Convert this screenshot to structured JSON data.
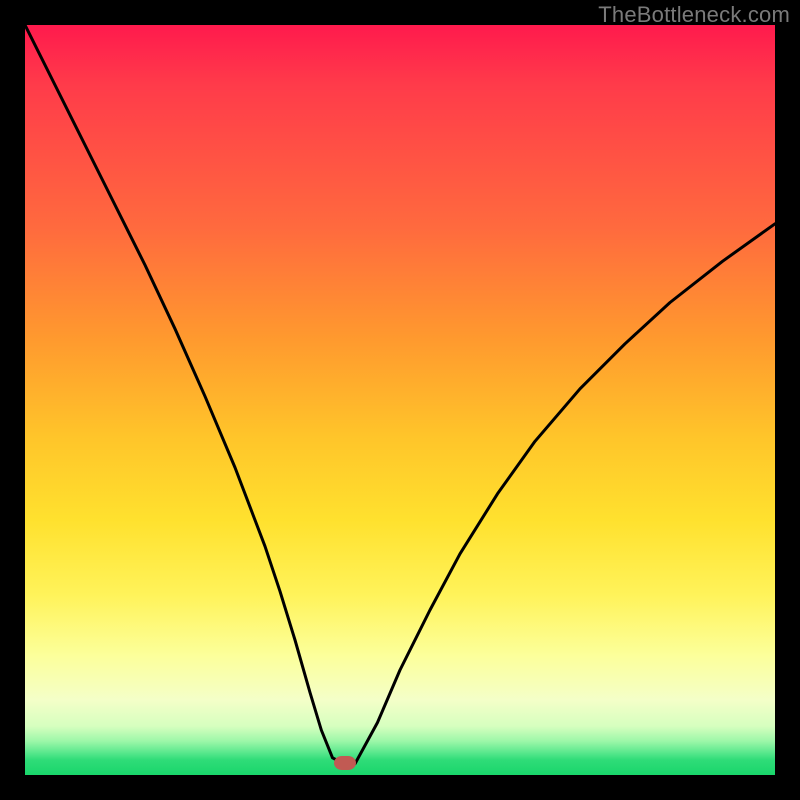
{
  "watermark": {
    "text": "TheBottleneck.com"
  },
  "chart_data": {
    "type": "line",
    "title": "",
    "xlabel": "",
    "ylabel": "",
    "xlim": [
      0,
      100
    ],
    "ylim": [
      0,
      100
    ],
    "grid": false,
    "legend": false,
    "series": [
      {
        "name": "curve",
        "x": [
          0,
          4,
          8,
          12,
          16,
          20,
          24,
          28,
          32,
          34,
          36,
          38,
          39.5,
          41,
          42.5,
          44,
          47,
          50,
          54,
          58,
          63,
          68,
          74,
          80,
          86,
          93,
          100
        ],
        "y": [
          100,
          92,
          84,
          76,
          68,
          59.5,
          50.5,
          41,
          30.5,
          24.5,
          18,
          11,
          6,
          2.3,
          1.5,
          1.5,
          7,
          14,
          22,
          29.5,
          37.5,
          44.5,
          51.5,
          57.5,
          63,
          68.5,
          73.5
        ]
      }
    ],
    "marker": {
      "x": 42.6,
      "y": 1.6,
      "color": "#c15a53"
    },
    "gradient_stops": [
      {
        "pos": 0,
        "color": "#ff1a4d"
      },
      {
        "pos": 0.27,
        "color": "#ff6a3e"
      },
      {
        "pos": 0.55,
        "color": "#ffc52a"
      },
      {
        "pos": 0.76,
        "color": "#fff35a"
      },
      {
        "pos": 0.9,
        "color": "#f4ffc8"
      },
      {
        "pos": 0.97,
        "color": "#5ae88d"
      },
      {
        "pos": 1.0,
        "color": "#19d66b"
      }
    ]
  }
}
